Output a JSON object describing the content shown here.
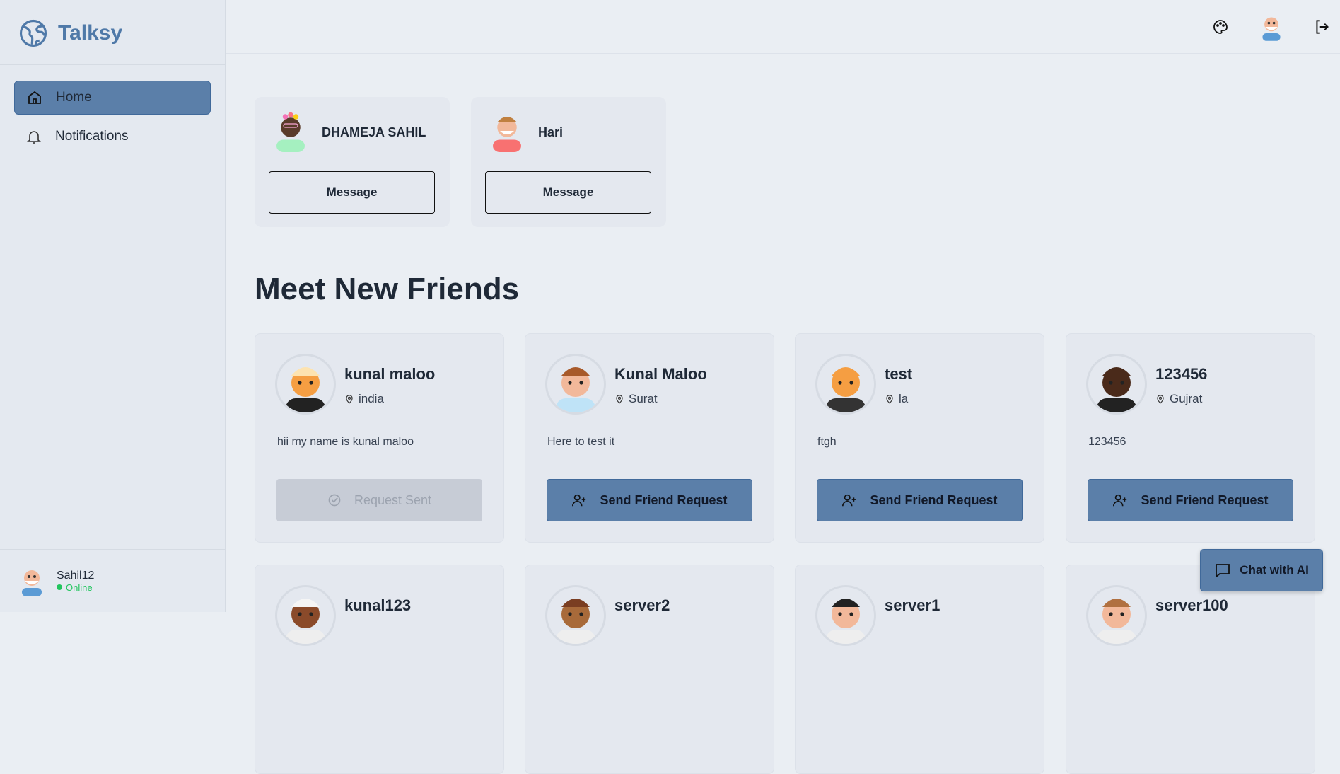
{
  "app": {
    "name": "Talksy",
    "brand_color": "#4f79a8",
    "accent": "#5b7fa9"
  },
  "sidebar": {
    "items": [
      {
        "label": "Home",
        "icon": "home-icon",
        "active": true
      },
      {
        "label": "Notifications",
        "icon": "bell-icon",
        "active": false
      }
    ],
    "user": {
      "name": "Sahil12",
      "status": "Online"
    }
  },
  "header": {
    "icons": [
      "palette-icon",
      "avatar",
      "logout-icon"
    ]
  },
  "friends": [
    {
      "name": "DHAMEJA SAHIL",
      "button": "Message"
    },
    {
      "name": "Hari",
      "button": "Message"
    }
  ],
  "section_title": "Meet New Friends",
  "suggestions": [
    {
      "name": "kunal maloo",
      "location": "india",
      "bio": "hii my name is kunal maloo",
      "button": "Request Sent",
      "sent": true
    },
    {
      "name": "Kunal Maloo",
      "location": "Surat",
      "bio": "Here to test it",
      "button": "Send Friend Request",
      "sent": false
    },
    {
      "name": "test",
      "location": "la",
      "bio": "ftgh",
      "button": "Send Friend Request",
      "sent": false
    },
    {
      "name": "123456",
      "location": "Gujrat",
      "bio": "123456",
      "button": "Send Friend Request",
      "sent": false
    },
    {
      "name": "kunal123"
    },
    {
      "name": "server2"
    },
    {
      "name": "server1"
    },
    {
      "name": "server100"
    }
  ],
  "chat_ai": {
    "label": "Chat with AI"
  }
}
